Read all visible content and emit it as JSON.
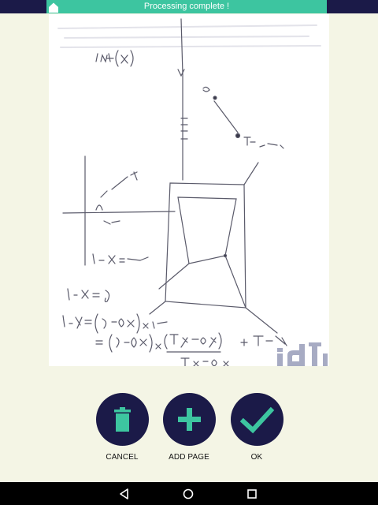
{
  "status_bar": {
    "banner_text": "Processing complete !",
    "home_icon": "home-icon"
  },
  "document": {
    "description_icon": "scanned-page",
    "watermark": "idTi"
  },
  "actions": [
    {
      "label": "CANCEL",
      "icon": "trash-icon"
    },
    {
      "label": "ADD PAGE",
      "icon": "plus-icon"
    },
    {
      "label": "OK",
      "icon": "check-icon"
    }
  ],
  "navigation": {
    "back_icon": "back-triangle-icon",
    "home_icon": "home-circle-icon",
    "recents_icon": "recents-square-icon"
  },
  "colors": {
    "accent": "#3dc5a0",
    "dark": "#1b1a48",
    "background": "#f4f5e5"
  }
}
